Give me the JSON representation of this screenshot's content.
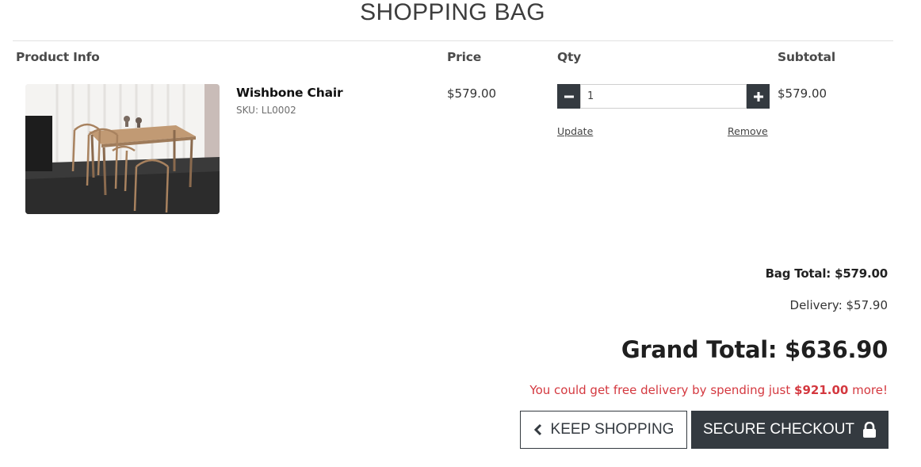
{
  "page": {
    "title": "SHOPPING BAG"
  },
  "table_headers": [
    "Product Info",
    "Price",
    "Qty",
    "Subtotal"
  ],
  "cart": {
    "items": [
      {
        "name": "Wishbone Chair",
        "sku": "SKU: LL0002",
        "price": "$579.00",
        "quantity": "1",
        "subtotal": "$579.00",
        "update_label": "Update",
        "remove_label": "Remove",
        "image_icon": "product-photo-dining-table-chairs"
      }
    ]
  },
  "summary": {
    "bag_total": "Bag Total: $579.00",
    "delivery": "Delivery: $57.90",
    "grand_total": "Grand Total: $636.90",
    "free_delivery_prefix": "You could get free delivery by spending just ",
    "free_delivery_amount": "$921.00",
    "free_delivery_suffix": " more!"
  },
  "buttons": {
    "keep_shopping": "KEEP SHOPPING",
    "secure_checkout": "SECURE CHECKOUT"
  },
  "icons": {
    "minus": "minus-icon",
    "plus": "plus-icon",
    "back": "chevron-left-icon",
    "lock": "lock-icon"
  },
  "colors": {
    "dark": "#343a40",
    "alert": "#d4383f",
    "rule": "#e2e2e2"
  }
}
